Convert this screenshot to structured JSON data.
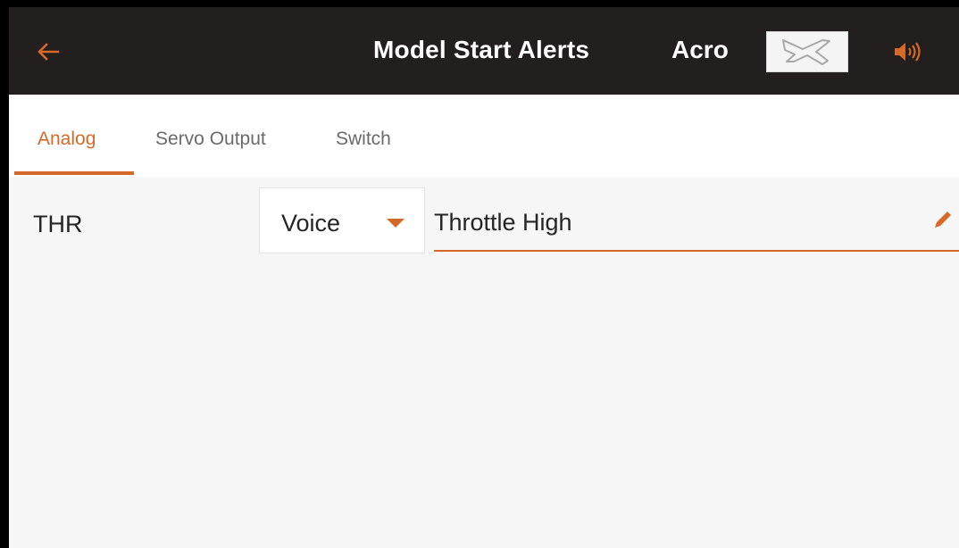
{
  "header": {
    "title": "Model Start Alerts",
    "model_name": "Acro",
    "back_icon": "arrow-left-icon",
    "model_image_icon": "airplane-icon",
    "speaker_icon": "speaker-icon"
  },
  "tabs": [
    {
      "label": "Analog",
      "active": true
    },
    {
      "label": "Servo Output",
      "active": false
    },
    {
      "label": "Switch",
      "active": false
    }
  ],
  "alerts": [
    {
      "label": "THR",
      "type": "Voice",
      "message": "Throttle High",
      "edit_icon": "pencil-icon"
    }
  ],
  "colors": {
    "accent": "#d4692a",
    "header_bg": "#231f1e",
    "tab_bg": "#ffffff",
    "content_bg": "#f6f6f6",
    "text": "#252525",
    "inactive_tab": "#6a6a6a"
  }
}
